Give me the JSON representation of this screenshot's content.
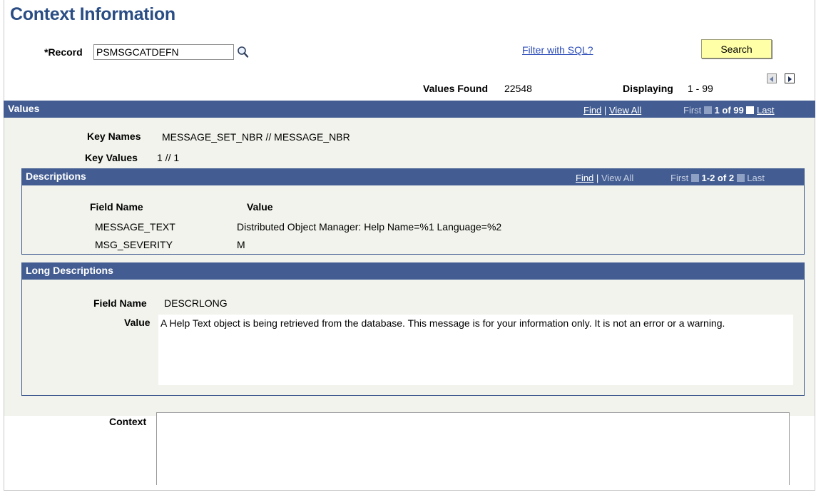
{
  "page": {
    "title": "Context Information"
  },
  "record": {
    "label": "*Record",
    "value": "PSMSGCATDEFN"
  },
  "filter_link": "Filter with SQL?",
  "search_button": "Search",
  "summary": {
    "values_found_label": "Values Found",
    "values_found": "22548",
    "displaying_label": "Displaying",
    "displaying": "1 - 99"
  },
  "values_section": {
    "title": "Values",
    "find": "Find",
    "sep": "|",
    "view_all": "View All",
    "first": "First",
    "count": "1 of 99",
    "last": "Last",
    "key_names_label": "Key Names",
    "key_names": "MESSAGE_SET_NBR // MESSAGE_NBR",
    "key_values_label": "Key Values",
    "key_values": "1 // 1"
  },
  "descriptions": {
    "title": "Descriptions",
    "find": "Find",
    "sep": "|",
    "view_all": "View All",
    "first": "First",
    "count": "1-2 of 2",
    "last": "Last",
    "col_field": "Field Name",
    "col_value": "Value",
    "rows": [
      {
        "field": "MESSAGE_TEXT",
        "value": "Distributed Object Manager: Help Name=%1 Language=%2"
      },
      {
        "field": "MSG_SEVERITY",
        "value": "M"
      }
    ]
  },
  "long_descriptions": {
    "title": "Long Descriptions",
    "field_label": "Field Name",
    "field": "DESCRLONG",
    "value_label": "Value",
    "value": "A Help Text object is being retrieved from the database. This message is for your information only. It is not an error or a warning."
  },
  "context": {
    "label": "Context",
    "value": ""
  },
  "icons": {
    "lookup": "magnifier-icon",
    "prev": "left-arrow-icon",
    "next": "right-arrow-icon"
  },
  "colors": {
    "bar": "#435d92",
    "title": "#2a4d84",
    "button": "#ffffa8",
    "panel_bg": "#f1f3ec"
  }
}
